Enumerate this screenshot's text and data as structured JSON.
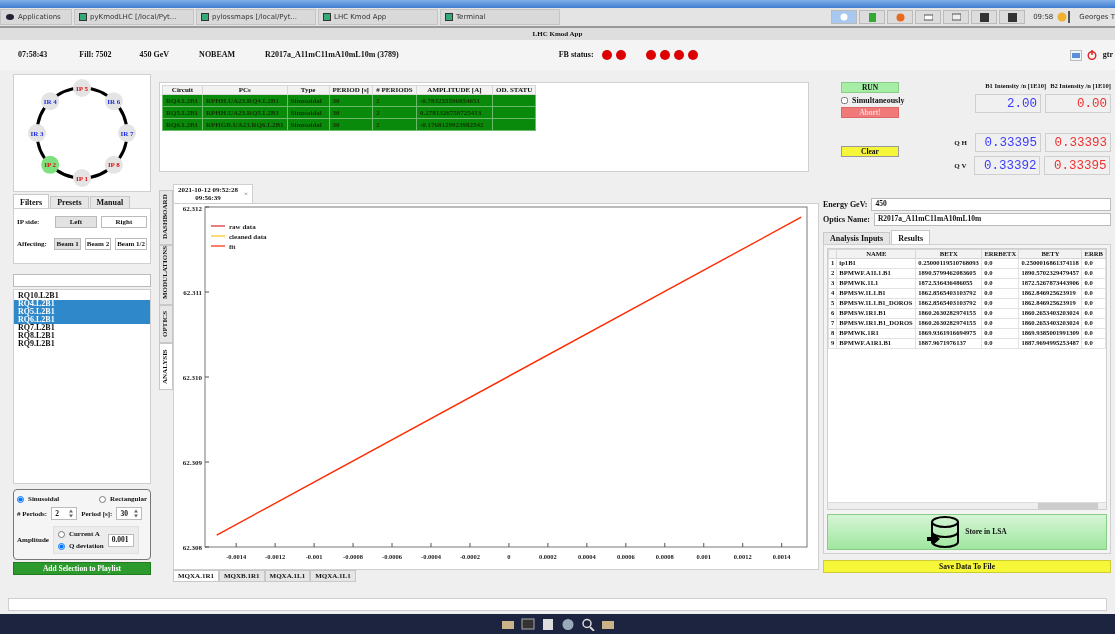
{
  "window": {
    "title": "LHC Kmod App"
  },
  "taskbar": {
    "menu": "Applications",
    "tasks": [
      {
        "label": "pyKmodLHC [/local/Pyt..."
      },
      {
        "label": "pylossmaps [/local/Pyt..."
      },
      {
        "label": "LHC Kmod App"
      },
      {
        "label": "Terminal"
      }
    ],
    "clock": "09:58",
    "user": "Georges T"
  },
  "header": {
    "time": "07:58:43",
    "fill": "Fill:  7502",
    "energy": "450 GeV",
    "mode": "NOBEAM",
    "optics": "R2017a_A11mC11mA10mL10m (3789)",
    "fb_label": "FB status:",
    "fb_dots": [
      {
        "color": "#dd0000"
      },
      {
        "color": "#dd0000"
      }
    ],
    "status_dots": [
      {
        "color": "#dd0000"
      },
      {
        "color": "#dd0000"
      },
      {
        "color": "#dd0000"
      },
      {
        "color": "#dd0000"
      }
    ],
    "user": "gtr"
  },
  "ring": {
    "nodes": [
      {
        "label": "IP 5",
        "kind": "ip",
        "selected": false
      },
      {
        "label": "IR 6",
        "kind": "ir",
        "selected": false
      },
      {
        "label": "IR 7",
        "kind": "ir",
        "selected": false
      },
      {
        "label": "IP 8",
        "kind": "ip",
        "selected": false
      },
      {
        "label": "IP 1",
        "kind": "ip",
        "selected": false
      },
      {
        "label": "IP 2",
        "kind": "ip",
        "selected": true
      },
      {
        "label": "IR 3",
        "kind": "ir",
        "selected": false
      },
      {
        "label": "IR 4",
        "kind": "ir",
        "selected": false
      }
    ]
  },
  "filter_tabs": [
    {
      "label": "Filters",
      "selected": true
    },
    {
      "label": "Presets",
      "selected": false
    },
    {
      "label": "Manual",
      "selected": false
    }
  ],
  "ip_side": {
    "label": "IP side:",
    "options": [
      {
        "label": "Left",
        "selected": true
      },
      {
        "label": "Right",
        "selected": false
      }
    ]
  },
  "affecting": {
    "label": "Affecting:",
    "options": [
      {
        "label": "Beam 1",
        "selected": true
      },
      {
        "label": "Beam 2",
        "selected": false
      },
      {
        "label": "Beam 1/2",
        "selected": false
      }
    ]
  },
  "circuits": [
    {
      "label": "RQ10.L2B1",
      "selected": false
    },
    {
      "label": "RQ4.L2B1",
      "selected": true
    },
    {
      "label": "RQ5.L2B1",
      "selected": true
    },
    {
      "label": "RQ6.L2B1",
      "selected": true
    },
    {
      "label": "RQ7.L2B1",
      "selected": false
    },
    {
      "label": "RQ8.L2B1",
      "selected": false
    },
    {
      "label": "RQ9.L2B1",
      "selected": false
    }
  ],
  "waveform": {
    "shapes": [
      {
        "label": "Sinusoidal",
        "selected": true
      },
      {
        "label": "Rectangular",
        "selected": false
      }
    ],
    "periods_label": "# Periods:",
    "periods": "2",
    "period_label": "Period [s]:",
    "period": "30",
    "amplitude_label": "Amplitude",
    "amplitude_modes": [
      {
        "label": "Current A",
        "selected": false
      },
      {
        "label": "Q deviation",
        "selected": true
      }
    ],
    "amplitude": "0.001"
  },
  "add_button": "Add Selection to Playlist",
  "side_tabs": [
    {
      "label": "DASHBOARD",
      "selected": false
    },
    {
      "label": "MODULATIONS",
      "selected": false
    },
    {
      "label": "OPTICS",
      "selected": false
    },
    {
      "label": "ANALYSIS",
      "selected": true
    }
  ],
  "playlist": {
    "columns": [
      "Circuit",
      "PCs",
      "Type",
      "PERIOD [s]",
      "# PERIODS",
      "AMPLITUDE [A]",
      "OD. STATU"
    ],
    "rows": [
      [
        "RQ4.L2B1",
        "RPHH.UA23.RQ4.L2B1",
        "Sinusoidal",
        "30",
        "2",
        "-0.783255590854651"
      ],
      [
        "RQ5.L2B1",
        "RPHH.UA23.RQ5.L2B1",
        "Sinusoidal",
        "30",
        "2",
        "0.2781326758725413"
      ],
      [
        "RQ6.L2B1",
        "RPHGB.UA23.RQ6.L2B1",
        "Sinusoidal",
        "30",
        "2",
        "-0.1768129923982542"
      ]
    ]
  },
  "controls": {
    "run": "RUN",
    "simultaneous": {
      "label": "Simultaneously",
      "checked": false
    },
    "abort": {
      "label": "Abort!",
      "disabled": true
    },
    "clear": "Clear"
  },
  "intensity": {
    "b1_header": "B1 Intensity /n [1E10]",
    "b2_header": "B2 Intensity /n [1E10]",
    "b1": "2.00",
    "b2": "0.00"
  },
  "tunes": [
    {
      "label": "Q H",
      "b1": "0.33395",
      "b2": "0.33393"
    },
    {
      "label": "Q V",
      "b1": "0.33392",
      "b2": "0.33395"
    }
  ],
  "result_tab": {
    "lines": [
      "2021-10-12 09:52:28",
      "09:56:39"
    ],
    "close": "×"
  },
  "chart_data": {
    "type": "line",
    "x": [
      -0.0015,
      0.0015
    ],
    "series": [
      {
        "name": "raw data",
        "color": "#d62728",
        "values": [
          null,
          null
        ]
      },
      {
        "name": "cleaned data",
        "color": "#f5c518",
        "values": [
          null,
          null
        ]
      },
      {
        "name": "fit",
        "color": "#ff2a00",
        "values": [
          62.30814,
          62.31188
        ]
      }
    ],
    "xlim": [
      -0.00156,
      0.00153
    ],
    "ylim": [
      62.308,
      62.312
    ],
    "xticks": [
      -0.0014,
      -0.0012,
      -0.001,
      -0.0008,
      -0.0006,
      -0.0004,
      -0.0002,
      0,
      0.0002,
      0.0004,
      0.0006,
      0.0008,
      0.001,
      0.0012,
      0.0014
    ],
    "yticks": [
      62.308,
      62.309,
      {
        "value": 62.31,
        "label": "62.310"
      },
      62.311,
      62.312
    ]
  },
  "magnet_tabs": [
    {
      "label": "MQXA.1R1",
      "selected": true
    },
    {
      "label": "MQXB.1R1",
      "selected": false
    },
    {
      "label": "MQXA.1L1",
      "selected": false
    },
    {
      "label": "MQXA.1L1",
      "selected": false
    }
  ],
  "analysis": {
    "energy_label": "Energy GeV:",
    "energy": "450",
    "optics_label": "Optics Name:",
    "optics": "R2017a_A11mC11mA10mL10m",
    "tabs": [
      {
        "label": "Analysis Inputs",
        "selected": false
      },
      {
        "label": "Results",
        "selected": true
      }
    ],
    "columns": [
      "NAME",
      "BETX",
      "ERRBETX",
      "BETY",
      "ERRB"
    ],
    "rows": [
      {
        "index": "1",
        "cells": [
          "ip1B1",
          "0.25000119510768093",
          "0.0",
          "0.2500016861374118",
          "0.0"
        ]
      },
      {
        "index": "2",
        "cells": [
          "BPMWF.A1L1.B1",
          "1890.5799462083605",
          "0.0",
          "1890.5702329479457",
          "0.0"
        ]
      },
      {
        "index": "3",
        "cells": [
          "BPMWK.1L1",
          "1872.536436486055",
          "0.0",
          "1872.5267873443906",
          "0.0"
        ]
      },
      {
        "index": "4",
        "cells": [
          "BPMSW.1L1.B1",
          "1862.8565403103792",
          "0.0",
          "1862.846925623919",
          "0.0"
        ]
      },
      {
        "index": "5",
        "cells": [
          "BPMSW.1L1.B1_DOROS",
          "1862.8565403103792",
          "0.0",
          "1862.846925623919",
          "0.0"
        ]
      },
      {
        "index": "6",
        "cells": [
          "BPMSW.1R1.B1",
          "1860.2630282974155",
          "0.0",
          "1860.2653403203024",
          "0.0"
        ]
      },
      {
        "index": "7",
        "cells": [
          "BPMSW.1R1.B1_DOROS",
          "1860.2630282974155",
          "0.0",
          "1860.2653403203024",
          "0.0"
        ]
      },
      {
        "index": "8",
        "cells": [
          "BPMWK.1R1",
          "1869.9361916694975",
          "0.0",
          "1869.9385001991309",
          "0.0"
        ]
      },
      {
        "index": "9",
        "cells": [
          "BPMWF.A1R1.B1",
          "1887.9671976137",
          "0.0",
          "1887.9694995253487",
          "0.0"
        ]
      }
    ],
    "store": "Store in LSA",
    "save": "Save Data To File"
  }
}
